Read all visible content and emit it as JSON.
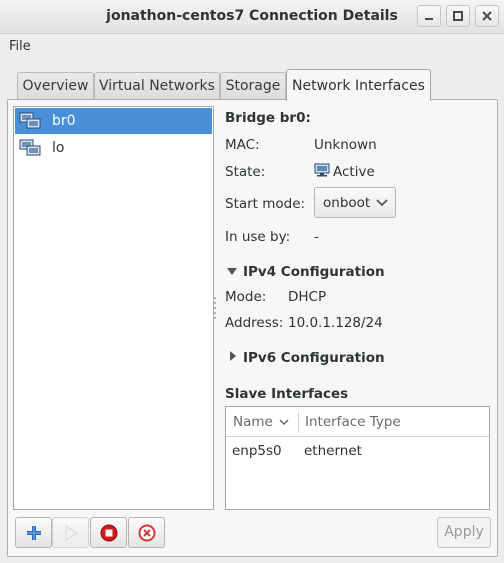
{
  "window": {
    "title": "jonathon-centos7 Connection Details"
  },
  "menu": {
    "file": "File"
  },
  "tabs": [
    {
      "label": "Overview"
    },
    {
      "label": "Virtual Networks"
    },
    {
      "label": "Storage"
    },
    {
      "label": "Network Interfaces",
      "active": true
    }
  ],
  "interfaces": [
    {
      "name": "br0",
      "selected": true,
      "icon": "network-computer-icon"
    },
    {
      "name": "lo",
      "selected": false,
      "icon": "network-computer-icon"
    }
  ],
  "details": {
    "heading": "Bridge br0:",
    "mac_label": "MAC:",
    "mac_value": "Unknown",
    "state_label": "State:",
    "state_value": "Active",
    "start_mode_label": "Start mode:",
    "start_mode_value": "onboot",
    "in_use_label": "In use by:",
    "in_use_value": "-"
  },
  "ipv4": {
    "heading": "IPv4 Configuration",
    "expanded": true,
    "mode_label": "Mode:",
    "mode_value": "DHCP",
    "address_label": "Address:",
    "address_value": "10.0.1.128/24"
  },
  "ipv6": {
    "heading": "IPv6 Configuration",
    "expanded": false
  },
  "slaves": {
    "heading": "Slave Interfaces",
    "columns": [
      "Name",
      "Interface Type"
    ],
    "rows": [
      {
        "name": "enp5s0",
        "type": "ethernet"
      }
    ]
  },
  "toolbar": {
    "add": "add-icon",
    "start": "play-icon",
    "stop": "stop-icon",
    "delete": "delete-icon",
    "apply_label": "Apply"
  },
  "colors": {
    "selection": "#4a90d9",
    "add_blue": "#3a76c4",
    "stop_red": "#d11a1a",
    "delete_red": "#cc3a3a"
  }
}
